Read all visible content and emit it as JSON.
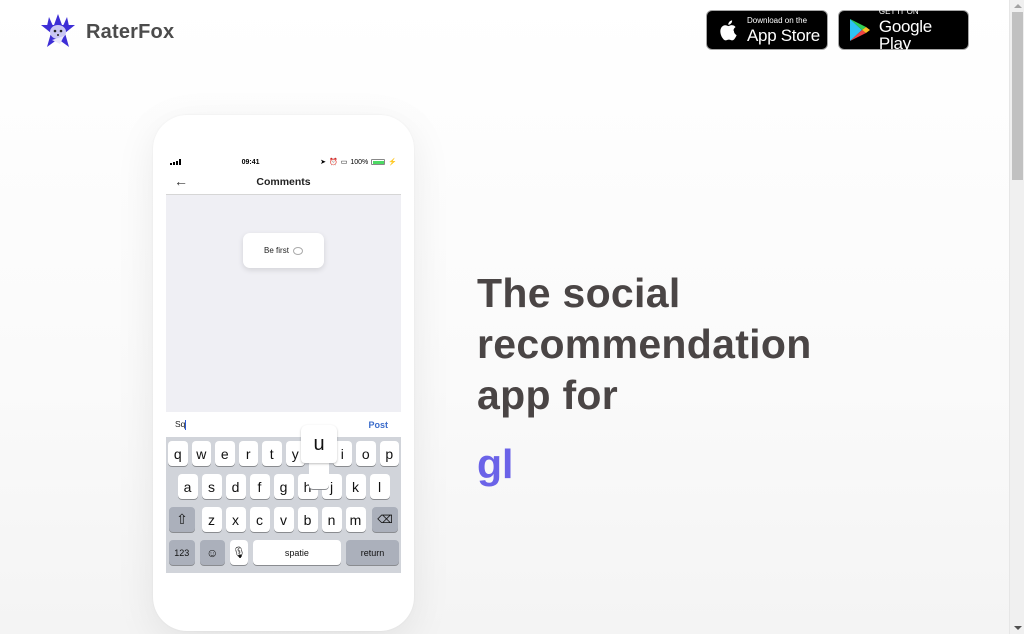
{
  "header": {
    "brand": "RaterFox",
    "logo_icon": "fox-star-logo-icon",
    "brand_color": "#3d2ed6",
    "app_store": {
      "small": "Download on the",
      "big": "App Store",
      "icon": "apple-icon"
    },
    "google_play": {
      "small": "GET IT ON",
      "big": "Google Play",
      "icon": "google-play-icon"
    }
  },
  "phone": {
    "status": {
      "time": "09:41",
      "battery": "100%",
      "battery_color": "#4cd964"
    },
    "nav": {
      "title": "Comments",
      "back_icon": "arrow-left-icon"
    },
    "empty_card": {
      "text": "Be first",
      "icon": "speech-bubble-icon"
    },
    "input": {
      "value": "Sq",
      "post": "Post"
    },
    "keyboard": {
      "row1": [
        "q",
        "w",
        "e",
        "r",
        "t",
        "y",
        "u",
        "i",
        "o",
        "p"
      ],
      "row2": [
        "a",
        "s",
        "d",
        "f",
        "g",
        "h",
        "j",
        "k",
        "l"
      ],
      "row3": [
        "z",
        "x",
        "c",
        "v",
        "b",
        "n",
        "m"
      ],
      "pressed": "u",
      "numbers": "123",
      "space": "spatie",
      "return": "return",
      "shift_icon": "shift-icon",
      "delete_icon": "backspace-icon",
      "emoji_icon": "emoji-icon",
      "mic_icon": "microphone-icon"
    }
  },
  "hero": {
    "lines": [
      "The social",
      "recommendation",
      "app for"
    ],
    "typed": "gl",
    "typed_color": "#6b63e8"
  }
}
